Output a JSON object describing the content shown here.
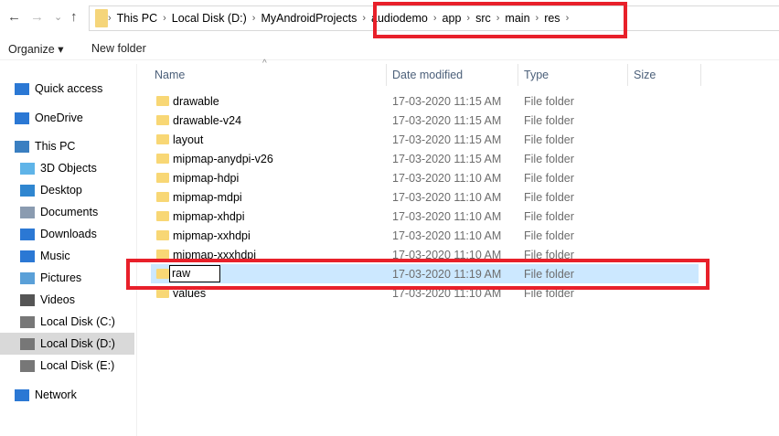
{
  "nav_buttons": {
    "back": "←",
    "forward": "→",
    "recent": "⌄",
    "up": "↑"
  },
  "breadcrumb": [
    "This PC",
    "Local Disk (D:)",
    "MyAndroidProjects",
    "audiodemo",
    "app",
    "src",
    "main",
    "res"
  ],
  "toolbar": {
    "organize": "Organize ▾",
    "new_folder": "New folder"
  },
  "sidebar": [
    {
      "label": "Quick access",
      "icon": "star-icon",
      "color": "#2b78d4"
    },
    {
      "label": "OneDrive",
      "icon": "cloud-icon",
      "color": "#2b78d4"
    },
    {
      "label": "This PC",
      "icon": "computer-icon",
      "color": "#3a7fc1"
    },
    {
      "label": "3D Objects",
      "icon": "cube-icon",
      "color": "#5fb4e8"
    },
    {
      "label": "Desktop",
      "icon": "desktop-icon",
      "color": "#2f86d0"
    },
    {
      "label": "Documents",
      "icon": "document-icon",
      "color": "#8a9bb0"
    },
    {
      "label": "Downloads",
      "icon": "download-icon",
      "color": "#2b78d4"
    },
    {
      "label": "Music",
      "icon": "music-icon",
      "color": "#2b78d4"
    },
    {
      "label": "Pictures",
      "icon": "pictures-icon",
      "color": "#5aa0d8"
    },
    {
      "label": "Videos",
      "icon": "video-icon",
      "color": "#555"
    },
    {
      "label": "Local Disk (C:)",
      "icon": "drive-icon",
      "color": "#777"
    },
    {
      "label": "Local Disk (D:)",
      "icon": "drive-icon",
      "color": "#777",
      "selected": true
    },
    {
      "label": "Local Disk (E:)",
      "icon": "drive-icon",
      "color": "#777"
    },
    {
      "label": "Network",
      "icon": "network-icon",
      "color": "#2b78d4"
    }
  ],
  "columns": {
    "name": "Name",
    "date": "Date modified",
    "type": "Type",
    "size": "Size"
  },
  "files": [
    {
      "name": "drawable",
      "date": "17-03-2020 11:15 AM",
      "type": "File folder"
    },
    {
      "name": "drawable-v24",
      "date": "17-03-2020 11:15 AM",
      "type": "File folder"
    },
    {
      "name": "layout",
      "date": "17-03-2020 11:15 AM",
      "type": "File folder"
    },
    {
      "name": "mipmap-anydpi-v26",
      "date": "17-03-2020 11:15 AM",
      "type": "File folder"
    },
    {
      "name": "mipmap-hdpi",
      "date": "17-03-2020 11:10 AM",
      "type": "File folder"
    },
    {
      "name": "mipmap-mdpi",
      "date": "17-03-2020 11:10 AM",
      "type": "File folder"
    },
    {
      "name": "mipmap-xhdpi",
      "date": "17-03-2020 11:10 AM",
      "type": "File folder"
    },
    {
      "name": "mipmap-xxhdpi",
      "date": "17-03-2020 11:10 AM",
      "type": "File folder"
    },
    {
      "name": "mipmap-xxxhdpi",
      "date": "17-03-2020 11:10 AM",
      "type": "File folder"
    },
    {
      "name": "raw",
      "date": "17-03-2020 11:19 AM",
      "type": "File folder",
      "editing": true
    },
    {
      "name": "values",
      "date": "17-03-2020 11:10 AM",
      "type": "File folder"
    }
  ],
  "highlight_color": "#e8202a"
}
